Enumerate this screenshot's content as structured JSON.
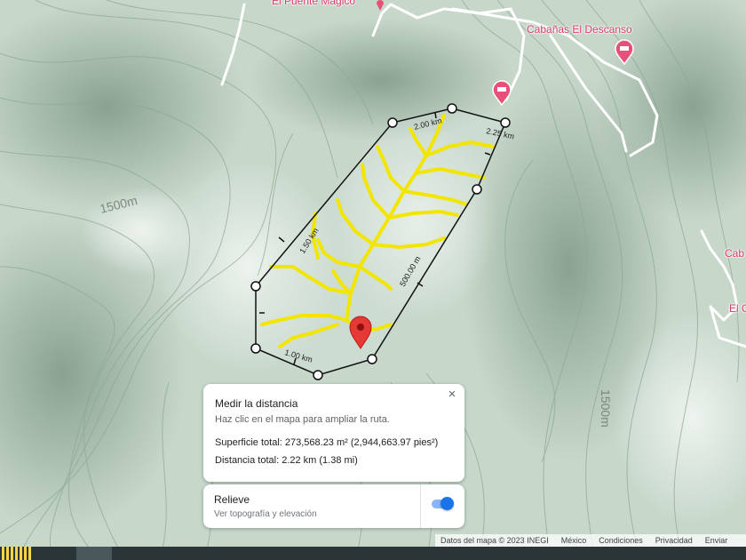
{
  "map": {
    "place_labels": {
      "puente": "El Puente Mágico",
      "cabanas": "Cabañas El Descanso",
      "cab_partial": "Cab",
      "el_partial": "El C"
    },
    "contour_labels": {
      "left": "1500m",
      "right": "1500m"
    },
    "segment_labels": {
      "top": "2.00 km",
      "top_right": "2.25 km",
      "left": "1.50 km",
      "right": "500.00 m",
      "bottom": "1.00 km"
    },
    "colors": {
      "terrain_low": "#dfe9e0",
      "terrain_high": "#8ea596",
      "road": "#ffffff",
      "stream": "#f2e600",
      "pin": "#e53935",
      "measure_line": "#111111"
    },
    "icons": [
      "hotel-icon",
      "location-pin-icon",
      "close-icon"
    ]
  },
  "measure": {
    "title": "Medir la distancia",
    "hint": "Haz clic en el mapa para ampliar la ruta.",
    "area": "Superficie total: 273,568.23 m² (2,944,663.97 pies²)",
    "distance": "Distancia total: 2.22 km (1.38 mi)",
    "close": "×"
  },
  "relief": {
    "title": "Relieve",
    "subtitle": "Ver topografía y elevación",
    "enabled": true
  },
  "footer": {
    "data": "Datos del mapa © 2023 INEGI",
    "country": "México",
    "terms": "Condiciones",
    "privacy": "Privacidad",
    "send": "Enviar"
  }
}
